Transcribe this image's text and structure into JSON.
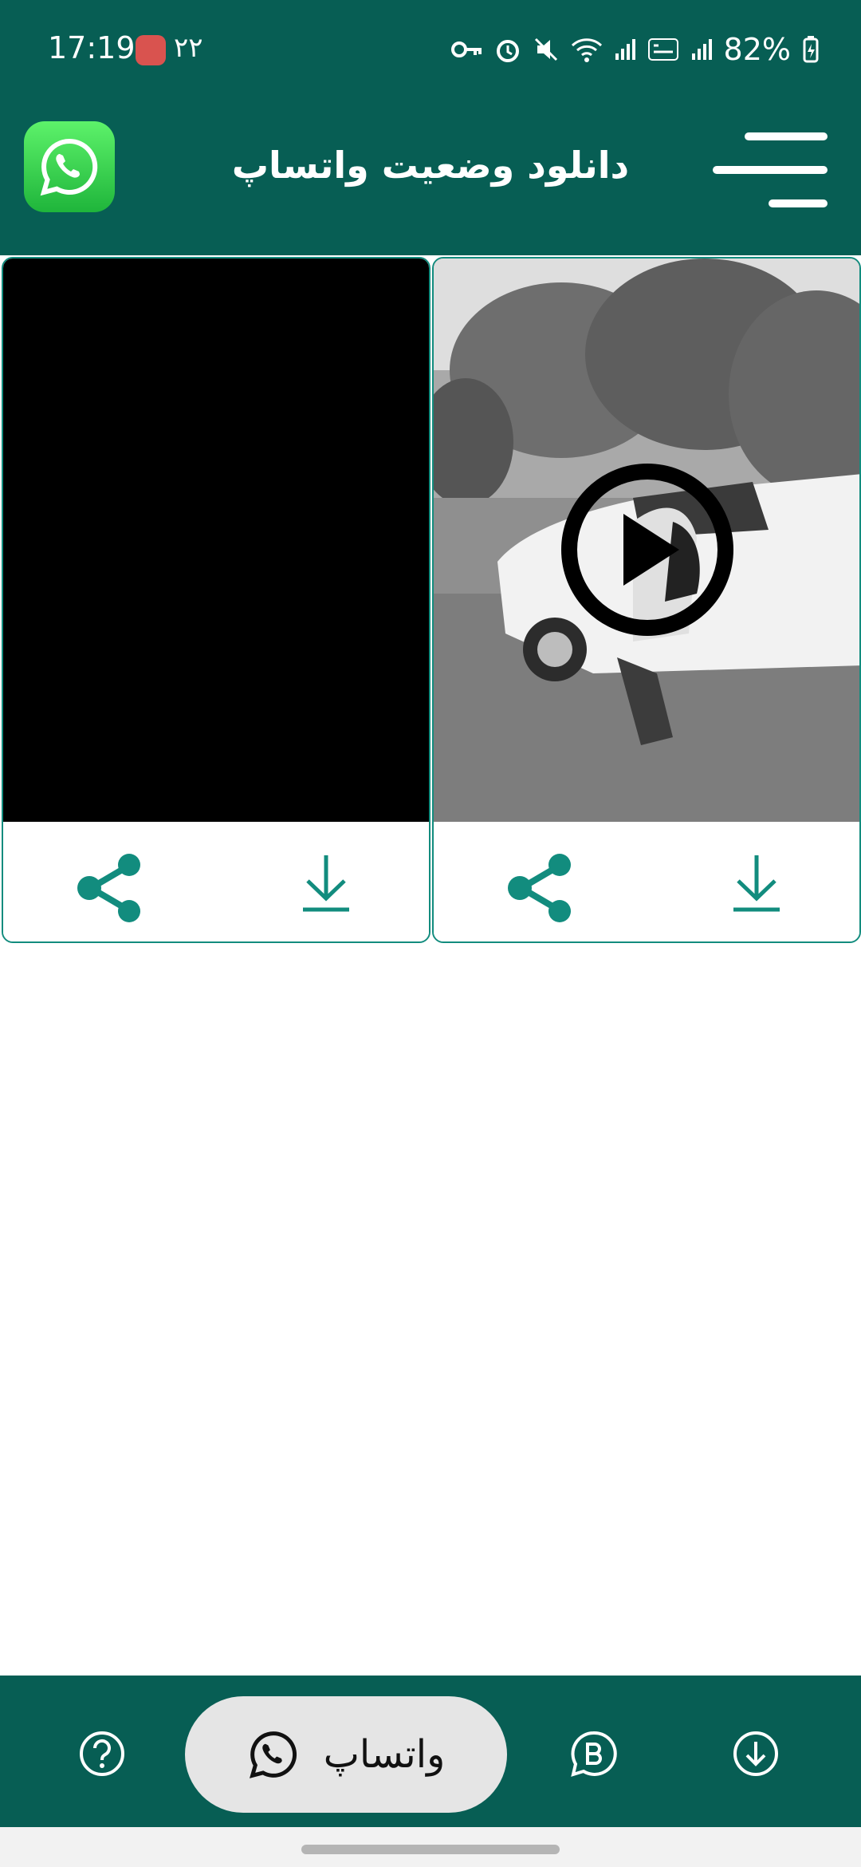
{
  "status_bar": {
    "time": "17:19",
    "notification_text": "۲۲",
    "battery": "82%"
  },
  "header": {
    "title": "دانلود وضعیت واتساپ",
    "logo_icon": "whatsapp-logo",
    "menu_icon": "menu-icon"
  },
  "cards": [
    {
      "type": "video-black",
      "actions": [
        "share",
        "download"
      ]
    },
    {
      "type": "video",
      "actions": [
        "share",
        "download"
      ],
      "play_icon": "play-icon"
    }
  ],
  "bottom_nav": {
    "items": [
      {
        "icon": "help-icon"
      },
      {
        "label": "واتساپ",
        "icon": "whatsapp-icon",
        "selected": true
      },
      {
        "icon": "whatsapp-business-icon"
      },
      {
        "icon": "download-circle-icon"
      }
    ]
  },
  "colors": {
    "primary": "#075e54",
    "accent": "#128c7e",
    "pill": "#e5e5e5"
  }
}
